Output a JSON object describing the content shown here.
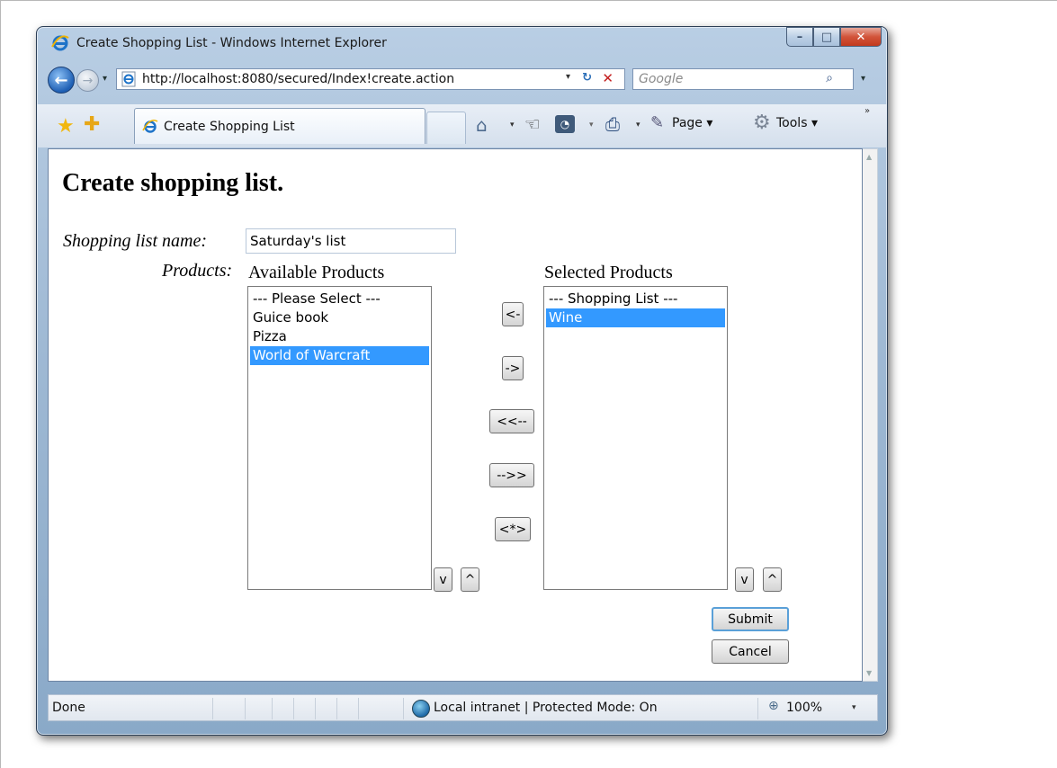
{
  "window": {
    "title": "Create Shopping List - Windows Internet Explorer",
    "controls": {
      "minimize": "–",
      "maximize": "□",
      "close": "✕"
    }
  },
  "addressbar": {
    "url": "http://localhost:8080/secured/Index!create.action",
    "search_placeholder": "Google",
    "dropdown_glyph": "▾",
    "refresh_glyph": "↻",
    "stop_glyph": "✕",
    "search_glyph": "⌕"
  },
  "commandbar": {
    "tab_label": "Create Shopping List",
    "page_label": "Page ▾",
    "tools_label": "Tools ▾",
    "overflow_glyph": "»",
    "dropdown_glyph": "▾",
    "favorites_glyph": "★",
    "add_favorites_glyph": "✚",
    "home_glyph": "⌂",
    "research_glyph": "☜",
    "rss_glyph": "◔",
    "print_glyph": "⎙",
    "page_icon_glyph": "✎",
    "tools_icon_glyph": "⚙"
  },
  "page": {
    "title": "Create shopping list.",
    "name_label": "Shopping list name:",
    "name_value": "Saturday's list",
    "products_label": "Products:",
    "available": {
      "heading": "Available Products",
      "options": [
        {
          "label": "--- Please Select ---",
          "selected": false
        },
        {
          "label": "Guice book",
          "selected": false
        },
        {
          "label": "Pizza",
          "selected": false
        },
        {
          "label": "World of Warcraft",
          "selected": true
        }
      ]
    },
    "selected": {
      "heading": "Selected Products",
      "options": [
        {
          "label": "--- Shopping List ---",
          "selected": false
        },
        {
          "label": "Wine",
          "selected": true
        }
      ]
    },
    "transfer_buttons": {
      "move_left": "<-",
      "move_right": "->",
      "move_all_left": "<<--",
      "move_all_right": "-->>",
      "swap_all": "<*>"
    },
    "order_buttons": {
      "down": "v",
      "up": "^"
    },
    "submit_label": "Submit",
    "cancel_label": "Cancel"
  },
  "statusbar": {
    "status": "Done",
    "zone": "Local intranet | Protected Mode: On",
    "zoom": "100%",
    "zoom_glyph": "⊕",
    "dropdown_glyph": "▾"
  },
  "colors": {
    "selection": "#3399ff",
    "window_frame": "#9fb9d4",
    "close_button": "#c2391d"
  }
}
